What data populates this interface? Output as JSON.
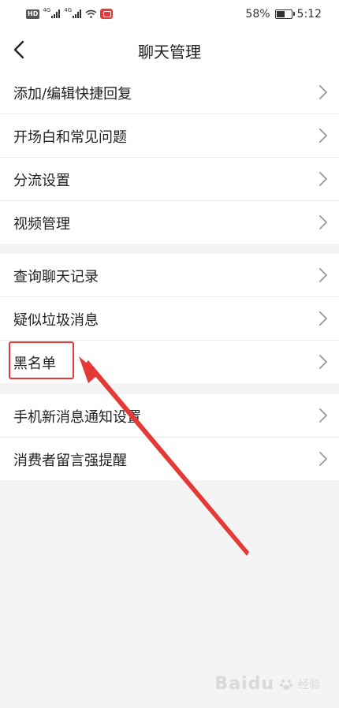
{
  "status_bar": {
    "hd_badge": "HD",
    "network_1": "4G",
    "network_2": "4G",
    "battery_percent": "58%",
    "battery_level": 0.58,
    "time": "5:12"
  },
  "header": {
    "title": "聊天管理"
  },
  "groups": [
    {
      "items": [
        {
          "label": "添加/编辑快捷回复"
        },
        {
          "label": "开场白和常见问题"
        },
        {
          "label": "分流设置"
        },
        {
          "label": "视频管理"
        }
      ]
    },
    {
      "items": [
        {
          "label": "查询聊天记录"
        },
        {
          "label": "疑似垃圾消息"
        },
        {
          "label": "黑名单"
        }
      ]
    },
    {
      "items": [
        {
          "label": "手机新消息通知设置"
        },
        {
          "label": "消费者留言强提醒"
        }
      ]
    }
  ],
  "annotation": {
    "highlight_target": "黑名单",
    "color": "#e53935"
  },
  "watermark": {
    "brand": "Baidu",
    "sub": "经验"
  }
}
